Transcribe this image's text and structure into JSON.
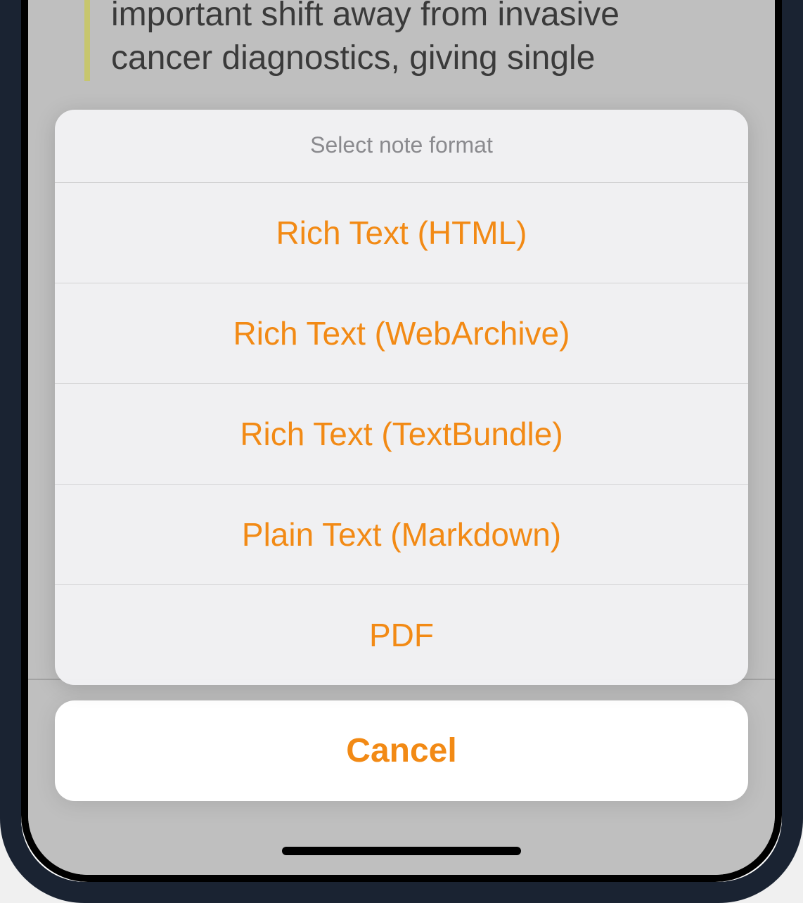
{
  "background": {
    "text_line1": "important shift away from invasive",
    "text_line2": "cancer diagnostics, giving single"
  },
  "sheet": {
    "title": "Select note format",
    "options": [
      {
        "label": "Rich Text (HTML)"
      },
      {
        "label": "Rich Text (WebArchive)"
      },
      {
        "label": "Rich Text (TextBundle)"
      },
      {
        "label": "Plain Text (Markdown)"
      },
      {
        "label": "PDF"
      }
    ],
    "cancel": "Cancel"
  }
}
